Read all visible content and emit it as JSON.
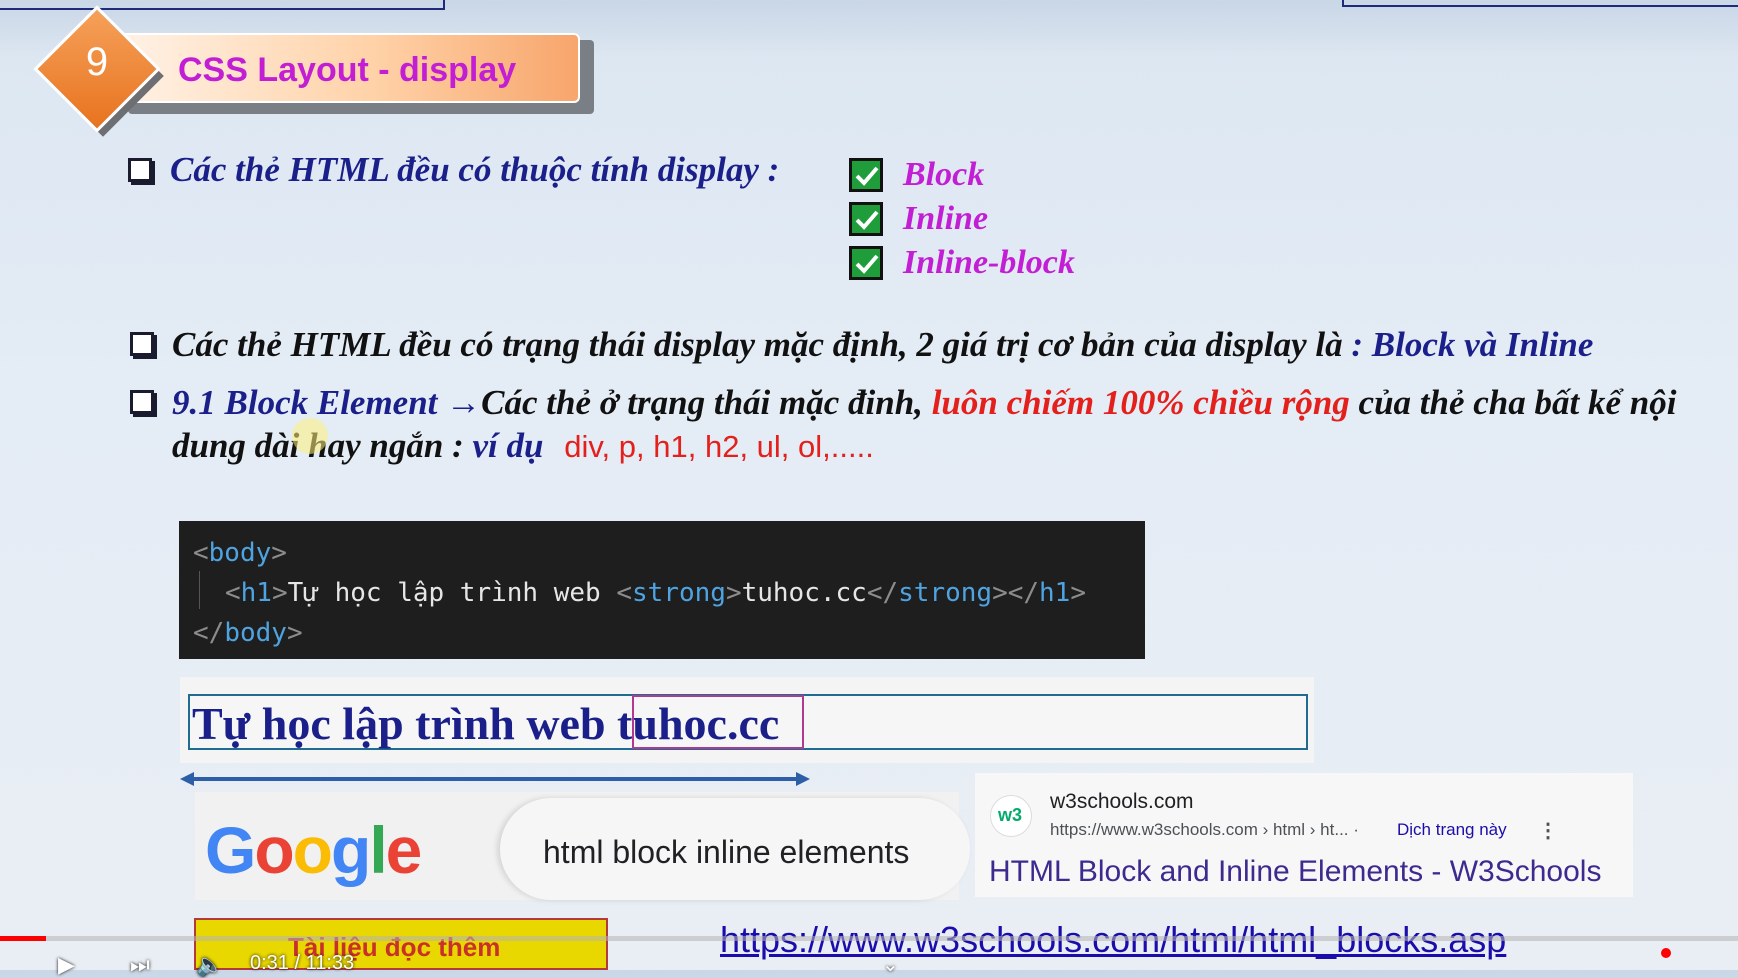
{
  "slide": {
    "number": "9",
    "title": "CSS Layout - display",
    "bullet1": "Các thẻ HTML đều có thuộc tính display :",
    "display_values": [
      "Block",
      "Inline",
      "Inline-block"
    ],
    "bullet2_text": "Các thẻ HTML đều có trạng thái display mặc định, 2 giá trị cơ bản của display là ",
    "bullet2_highlight": ": Block và Inline",
    "bullet3_heading": "9.1 Block Element",
    "bullet3_arrow": "→",
    "bullet3_text1": "Các thẻ ở trạng thái mặc đinh, ",
    "bullet3_red": "luôn chiếm 100% chiều rộng",
    "bullet3_text2": " của thẻ cha bất kể nội",
    "bullet3_line2": "dung dài hay ngắn : ",
    "bullet3_example_label": "ví dụ",
    "bullet3_examples": "div, p, h1, h2, ul, ol,....."
  },
  "code": {
    "line1_open": "<",
    "line1_tag": "body",
    "line1_close": ">",
    "line2_open1": "<",
    "line2_tag1": "h1",
    "line2_close1": ">",
    "line2_text": "Tự học lập trình web ",
    "line2_open2": "<",
    "line2_tag2": "strong",
    "line2_close2": ">",
    "line2_inner": "tuhoc.cc",
    "line2_end1": "</",
    "line2_tag3": "strong",
    "line2_end1_close": ">",
    "line2_end2": "</",
    "line2_tag4": "h1",
    "line2_end2_close": ">",
    "line3_open": "</",
    "line3_tag": "body",
    "line3_close": ">"
  },
  "demo": {
    "text": "Tự học lập trình web tuhoc.cc"
  },
  "google": {
    "logo_letters": [
      "G",
      "o",
      "o",
      "g",
      "l",
      "e"
    ],
    "logo_colors": [
      "#4285F4",
      "#EA4335",
      "#FBBC05",
      "#4285F4",
      "#34A853",
      "#EA4335"
    ],
    "query": "html block inline elements"
  },
  "result": {
    "icon": "w3",
    "site": "w3schools.com",
    "url": "https://www.w3schools.com › html › ht... ·",
    "translate": "Dịch trang này",
    "title": "HTML Block and Inline Elements - W3Schools"
  },
  "footer": {
    "extra_reading": "Tài liệu đọc thêm",
    "link": "https://www.w3schools.com/html/html_blocks.asp"
  },
  "video": {
    "progress": 0.027,
    "time": "0:31 / 11:33"
  }
}
